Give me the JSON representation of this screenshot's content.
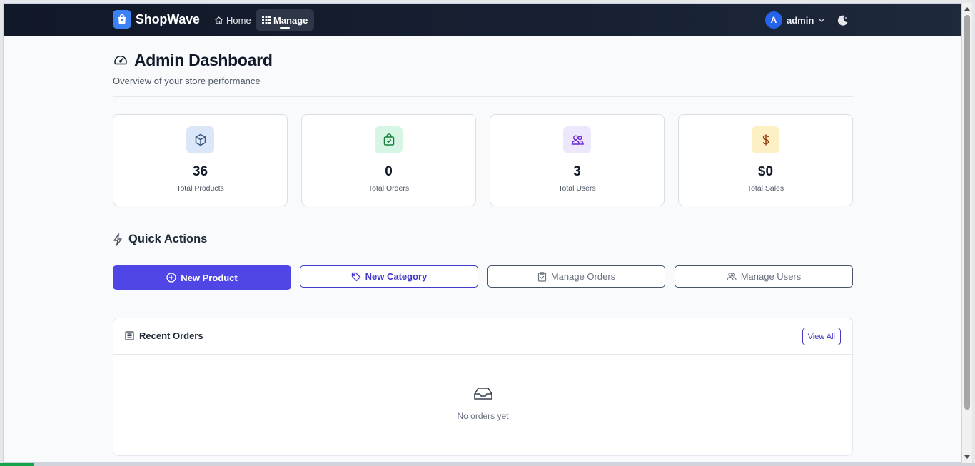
{
  "nav": {
    "brand": "ShopWave",
    "links": [
      {
        "label": "Home"
      },
      {
        "label": "Manage"
      }
    ],
    "user": {
      "avatar_initial": "A",
      "name": "admin"
    }
  },
  "header": {
    "title": "Admin Dashboard",
    "subtitle": "Overview of your store performance"
  },
  "stats": [
    {
      "value": "36",
      "label": "Total Products",
      "icon": "box-icon",
      "color": "#dbe7f8",
      "icon_color": "#3b5a80"
    },
    {
      "value": "0",
      "label": "Total Orders",
      "icon": "shopping-bag-check-icon",
      "color": "#d7f5e4",
      "icon_color": "#15803d"
    },
    {
      "value": "3",
      "label": "Total Users",
      "icon": "users-icon",
      "color": "#ece7fb",
      "icon_color": "#6d28d9"
    },
    {
      "value": "$0",
      "label": "Total Sales",
      "icon": "dollar-icon",
      "color": "#fdf0c4",
      "icon_color": "#92400e"
    }
  ],
  "quick_actions": {
    "title": "Quick Actions",
    "buttons": [
      {
        "label": "New Product",
        "icon": "plus-circle-icon"
      },
      {
        "label": "New Category",
        "icon": "tag-icon"
      },
      {
        "label": "Manage Orders",
        "icon": "clipboard-icon"
      },
      {
        "label": "Manage Users",
        "icon": "users-icon"
      }
    ]
  },
  "recent_orders": {
    "title": "Recent Orders",
    "view_all": "View All",
    "empty_text": "No orders yet"
  },
  "colors": {
    "primary": "#4f46e5",
    "navbar": "#111827",
    "brand_logo": "#3b82f6"
  }
}
